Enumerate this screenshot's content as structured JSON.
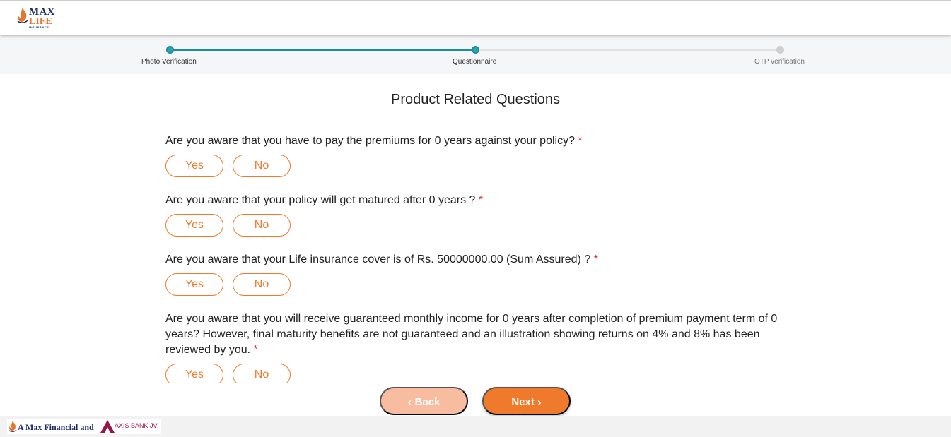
{
  "header": {
    "logo": {
      "line1": "MAX",
      "line2": "LIFE",
      "line3": "INSURANCE"
    }
  },
  "stepper": {
    "steps": [
      {
        "label": "Photo Verification",
        "state": "done"
      },
      {
        "label": "Questionnaire",
        "state": "current"
      },
      {
        "label": "OTP verification",
        "state": "pending"
      }
    ]
  },
  "page": {
    "title": "Product Related Questions"
  },
  "questions": [
    {
      "text": "Are you aware that you have to pay the premiums for 0 years against your policy?",
      "required_mark": "*",
      "yes": "Yes",
      "no": "No"
    },
    {
      "text": "Are you aware that your policy will get matured after 0 years ?",
      "required_mark": "*",
      "yes": "Yes",
      "no": "No"
    },
    {
      "text": "Are you aware that your Life insurance cover is of Rs. 50000000.00 (Sum Assured) ?",
      "required_mark": "*",
      "yes": "Yes",
      "no": "No"
    },
    {
      "text": "Are you aware that you will receive guaranteed monthly income for 0 years after completion of premium payment term of 0 years? However, final maturity benefits are not guaranteed and an illustration showing returns on 4% and 8% has been reviewed by you.",
      "required_mark": "*",
      "yes": "Yes",
      "no": "No"
    }
  ],
  "nav": {
    "back_label": "Back",
    "next_label": "Next"
  },
  "footer": {
    "brand_text": "A Max Financial and",
    "partner_text": "AXIS BANK JV"
  },
  "colors": {
    "accent": "#f07a2c",
    "progress": "#1a8f9c",
    "required": "#e0312b",
    "brand_navy": "#1c2d6b"
  }
}
